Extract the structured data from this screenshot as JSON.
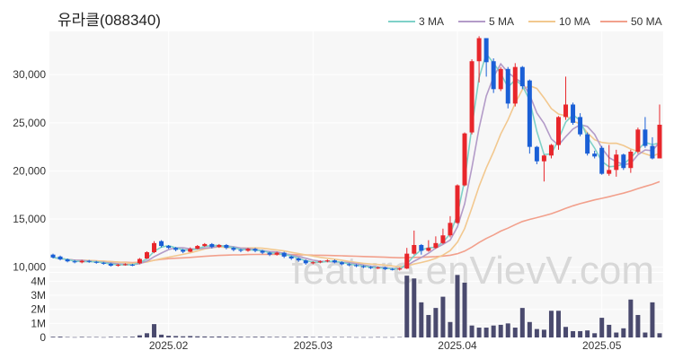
{
  "title": "유라클(088340)",
  "watermark": "feature.enVievV.com",
  "colors": {
    "up": "#e8262b",
    "down": "#1a5fd6",
    "volume": "#4a4a6e",
    "ma3": "#7fd1c8",
    "ma5": "#b39bc8",
    "ma10": "#f2c88f",
    "ma50": "#f2a08c",
    "panel_bg": "#f7f7f7",
    "grid": "#ffffff"
  },
  "chart_data": [
    {
      "type": "candlestick",
      "title": "유라클(088340)",
      "y_ticks": [
        10000,
        15000,
        20000,
        25000,
        30000
      ],
      "y_tick_labels": [
        "10,000",
        "15,000",
        "20,000",
        "25,000",
        "30,000"
      ],
      "ylim": [
        9500,
        34500
      ],
      "x_ticks": [
        "2025.02",
        "2025.03",
        "2025.04",
        "2025.05"
      ],
      "x_tick_index": [
        16,
        36,
        56,
        76
      ],
      "legend": [
        "3 MA",
        "5 MA",
        "10 MA",
        "50 MA"
      ],
      "legend_position": "top-right",
      "candles": [
        [
          11300,
          11000,
          11400,
          10900
        ],
        [
          11100,
          10800,
          11200,
          10700
        ],
        [
          10800,
          10600,
          10900,
          10500
        ],
        [
          10600,
          10500,
          10750,
          10400
        ],
        [
          10500,
          10650,
          10750,
          10400
        ],
        [
          10650,
          10550,
          10750,
          10450
        ],
        [
          10550,
          10450,
          10650,
          10350
        ],
        [
          10450,
          10350,
          10550,
          10250
        ],
        [
          10350,
          10150,
          10450,
          10050
        ],
        [
          10150,
          10250,
          10350,
          10050
        ],
        [
          10250,
          10300,
          10400,
          10150
        ],
        [
          10250,
          10200,
          10350,
          10100
        ],
        [
          10400,
          10850,
          10950,
          10300
        ],
        [
          10900,
          11550,
          11650,
          10850
        ],
        [
          11550,
          12500,
          12700,
          11450
        ],
        [
          12700,
          12200,
          12800,
          12050
        ],
        [
          12200,
          12000,
          12300,
          11900
        ],
        [
          12000,
          11800,
          12100,
          11650
        ],
        [
          11800,
          11600,
          11900,
          11450
        ],
        [
          11600,
          11900,
          12050,
          11550
        ],
        [
          11900,
          12200,
          12300,
          11850
        ],
        [
          12200,
          12400,
          12500,
          12100
        ],
        [
          12400,
          12100,
          12500,
          11950
        ],
        [
          12100,
          12300,
          12400,
          12000
        ],
        [
          12300,
          12000,
          12400,
          11850
        ],
        [
          12000,
          11800,
          12100,
          11650
        ],
        [
          11800,
          11700,
          11900,
          11550
        ],
        [
          11700,
          11900,
          12000,
          11600
        ],
        [
          11900,
          11700,
          12000,
          11550
        ],
        [
          11700,
          11500,
          11800,
          11350
        ],
        [
          11500,
          11300,
          11600,
          11150
        ],
        [
          11300,
          11500,
          11600,
          11200
        ],
        [
          11500,
          11100,
          11600,
          10950
        ],
        [
          11100,
          10900,
          11200,
          10750
        ],
        [
          10900,
          10700,
          11000,
          10550
        ],
        [
          10700,
          10400,
          10800,
          10250
        ],
        [
          10400,
          10500,
          10600,
          10300
        ],
        [
          10500,
          10600,
          10700,
          10400
        ],
        [
          10600,
          10700,
          10800,
          10500
        ],
        [
          10700,
          10500,
          10800,
          10400
        ],
        [
          10500,
          10300,
          10600,
          10200
        ],
        [
          10300,
          10200,
          10400,
          10100
        ],
        [
          10200,
          10100,
          10300,
          10000
        ],
        [
          10100,
          10000,
          10200,
          9900
        ],
        [
          10000,
          9900,
          10100,
          9800
        ],
        [
          9900,
          9950,
          10050,
          9800
        ],
        [
          9950,
          9800,
          10050,
          9700
        ],
        [
          9800,
          9750,
          9900,
          9650
        ],
        [
          9750,
          9850,
          9950,
          9650
        ],
        [
          9850,
          11400,
          12000,
          9800
        ],
        [
          11400,
          12300,
          13800,
          11300
        ],
        [
          12300,
          11700,
          12400,
          11300
        ],
        [
          11700,
          12000,
          12800,
          11600
        ],
        [
          12000,
          12500,
          13200,
          11900
        ],
        [
          12500,
          13300,
          14000,
          12400
        ],
        [
          13300,
          14600,
          15300,
          13100
        ],
        [
          14600,
          18500,
          18600,
          14500
        ],
        [
          18500,
          23900,
          24000,
          18400
        ],
        [
          24000,
          31400,
          31600,
          23800
        ],
        [
          31400,
          33800,
          34000,
          29200
        ],
        [
          33800,
          31300,
          31600,
          29800
        ],
        [
          31400,
          28500,
          31700,
          28100
        ],
        [
          28500,
          30600,
          30800,
          28300
        ],
        [
          30600,
          27000,
          30800,
          26500
        ],
        [
          27000,
          30800,
          31200,
          26700
        ],
        [
          30800,
          28800,
          30900,
          28500
        ],
        [
          29400,
          22500,
          29500,
          21800
        ],
        [
          22500,
          21000,
          22600,
          20700
        ],
        [
          21000,
          21600,
          21700,
          18900
        ],
        [
          21600,
          22700,
          22800,
          21300
        ],
        [
          22700,
          25600,
          25700,
          22200
        ],
        [
          25600,
          26900,
          29800,
          25300
        ],
        [
          26900,
          25000,
          27100,
          24800
        ],
        [
          25600,
          23800,
          26000,
          23600
        ],
        [
          23800,
          21800,
          24000,
          21600
        ],
        [
          21800,
          21500,
          22100,
          21300
        ],
        [
          22400,
          19700,
          22600,
          19600
        ],
        [
          19700,
          20100,
          22700,
          19500
        ],
        [
          20100,
          21700,
          22200,
          19400
        ],
        [
          21700,
          20300,
          21800,
          20100
        ],
        [
          20300,
          22000,
          22200,
          19800
        ],
        [
          22000,
          24300,
          24500,
          21800
        ],
        [
          24300,
          22600,
          25600,
          22400
        ],
        [
          22600,
          21300,
          23500,
          21200
        ],
        [
          21300,
          24800,
          26900,
          21600
        ]
      ],
      "volume_values": [
        0.05,
        0.06,
        0.03,
        0.02,
        0.04,
        0.03,
        0.03,
        0.02,
        0.04,
        0.03,
        0.04,
        0.05,
        0.15,
        0.3,
        0.95,
        0.2,
        0.12,
        0.1,
        0.08,
        0.1,
        0.08,
        0.07,
        0.06,
        0.07,
        0.06,
        0.05,
        0.05,
        0.04,
        0.05,
        0.05,
        0.04,
        0.04,
        0.04,
        0.03,
        0.04,
        0.05,
        0.03,
        0.04,
        0.03,
        0.03,
        0.03,
        0.03,
        0.02,
        0.02,
        0.02,
        0.03,
        0.02,
        0.02,
        0.03,
        4.4,
        4.2,
        2.5,
        1.6,
        2.1,
        2.9,
        1.1,
        4.45,
        3.9,
        0.85,
        0.7,
        0.7,
        0.85,
        0.9,
        1.0,
        0.7,
        2.1,
        1.1,
        0.6,
        0.55,
        1.9,
        1.9,
        0.75,
        0.45,
        0.45,
        0.5,
        0.3,
        1.4,
        0.9,
        0.35,
        0.65,
        2.7,
        1.6,
        0.35,
        2.5,
        0.3
      ]
    },
    {
      "type": "bar",
      "title": "",
      "y_ticks": [
        0,
        1,
        2,
        3,
        4
      ],
      "y_tick_labels": [
        "0",
        "1M",
        "2M",
        "3M",
        "4M"
      ],
      "ylim": [
        0,
        4.6
      ]
    }
  ]
}
